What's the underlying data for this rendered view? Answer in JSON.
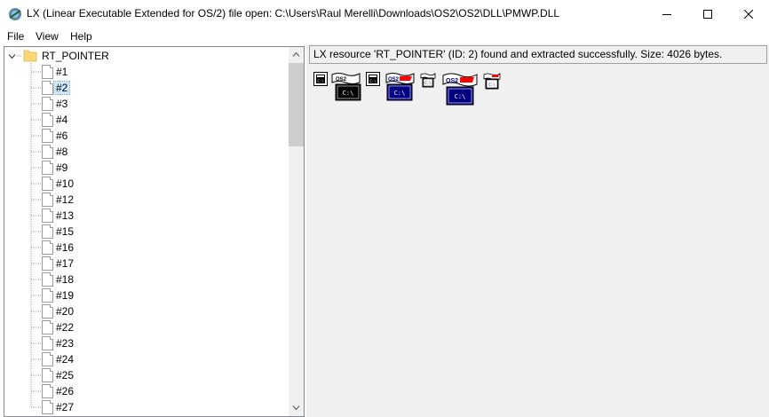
{
  "window": {
    "title": "LX (Linear Executable Extended for OS/2) file open: C:\\Users\\Raul Merelli\\Downloads\\OS2\\OS2\\DLL\\PMWP.DLL"
  },
  "menu": [
    "File",
    "View",
    "Help"
  ],
  "tree": {
    "root_label": "RT_POINTER",
    "items": [
      "#1",
      "#2",
      "#3",
      "#4",
      "#6",
      "#8",
      "#9",
      "#10",
      "#12",
      "#13",
      "#15",
      "#16",
      "#17",
      "#18",
      "#19",
      "#20",
      "#22",
      "#23",
      "#24",
      "#25",
      "#26",
      "#27"
    ],
    "selected_index": 1
  },
  "status": {
    "message": "LX resource 'RT_POINTER' (ID: 2) found and extracted successfully. Size: 4026 bytes."
  },
  "pointer_images": [
    {
      "caption": "C:\\",
      "screen_color": "#000000"
    },
    {
      "caption": "C:\\",
      "screen_color": "#000080"
    },
    {
      "caption": "C:\\",
      "screen_color": "#000080"
    }
  ],
  "pointer_logo_text": "OS2",
  "colors": {
    "selection": "#cce8ff",
    "folder": "#f8d775",
    "panel_bg": "#f0f0f0",
    "logo_red": "#ff0000"
  }
}
